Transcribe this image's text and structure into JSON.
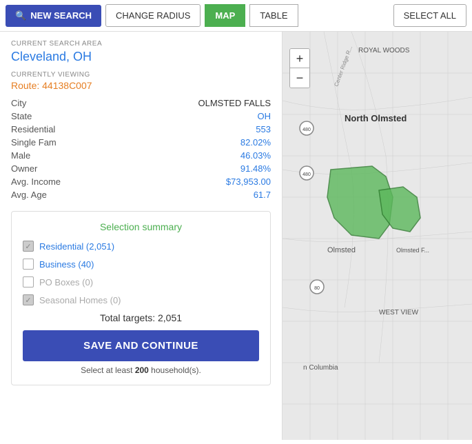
{
  "toolbar": {
    "new_search_label": "NEW SEARCH",
    "change_radius_label": "CHANGE RADIUS",
    "map_label": "MAP",
    "table_label": "TABLE",
    "select_all_label": "SELECT ALL"
  },
  "left_panel": {
    "current_search_area_label": "CURRENT SEARCH AREA",
    "search_area_value": "Cleveland, OH",
    "currently_viewing_label": "CURRENTLY VIEWING",
    "route_value": "Route: 44138C007",
    "data_rows": [
      {
        "label": "City",
        "value": "OLMSTED FALLS",
        "blue": false
      },
      {
        "label": "State",
        "value": "OH",
        "blue": true
      },
      {
        "label": "Residential",
        "value": "553",
        "blue": true
      },
      {
        "label": "Single Fam",
        "value": "82.02%",
        "blue": true
      },
      {
        "label": "Male",
        "value": "46.03%",
        "blue": true
      },
      {
        "label": "Owner",
        "value": "91.48%",
        "blue": true
      },
      {
        "label": "Avg. Income",
        "value": "$73,953.00",
        "blue": true
      },
      {
        "label": "Avg. Age",
        "value": "61.7",
        "blue": true
      }
    ],
    "selection_summary": {
      "title": "Selection summary",
      "items": [
        {
          "label": "Residential (2,051)",
          "checked": true,
          "active": true
        },
        {
          "label": "Business (40)",
          "checked": false,
          "active": true
        },
        {
          "label": "PO Boxes (0)",
          "checked": false,
          "active": false
        },
        {
          "label": "Seasonal Homes (0)",
          "checked": true,
          "active": false
        }
      ],
      "total_label": "Total targets: 2,051",
      "save_continue_label": "SAVE AND CONTINUE",
      "min_note_prefix": "Select at least ",
      "min_note_bold": "200",
      "min_note_suffix": " household(s)."
    }
  },
  "map": {
    "zoom_in": "+",
    "zoom_out": "−"
  }
}
